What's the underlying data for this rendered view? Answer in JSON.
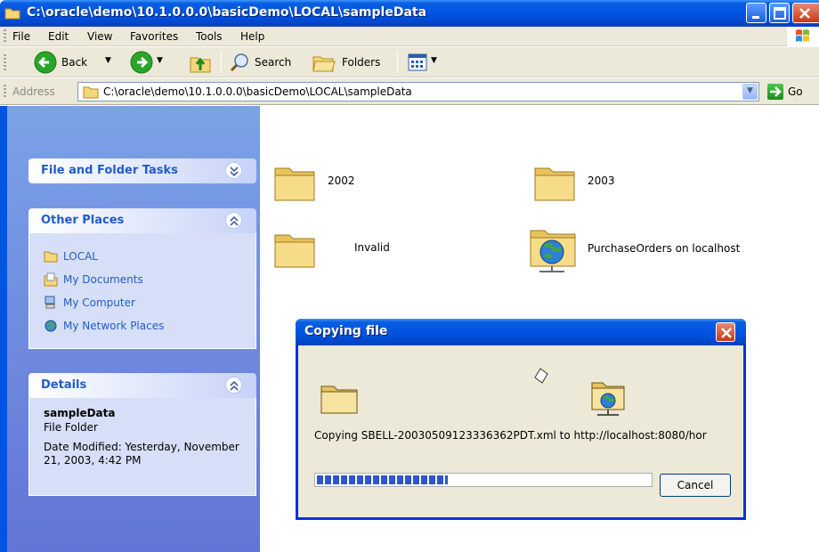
{
  "window": {
    "title": "C:\\oracle\\demo\\10.1.0.0.0\\basicDemo\\LOCAL\\sampleData"
  },
  "menu": [
    "File",
    "Edit",
    "View",
    "Favorites",
    "Tools",
    "Help"
  ],
  "toolbar": {
    "back_label": "Back",
    "search_label": "Search",
    "folders_label": "Folders"
  },
  "address": {
    "label": "Address",
    "value": "C:\\oracle\\demo\\10.1.0.0.0\\basicDemo\\LOCAL\\sampleData",
    "go_label": "Go"
  },
  "taskpane": {
    "file_folder_tasks": {
      "title": "File and Folder Tasks"
    },
    "other_places": {
      "title": "Other Places",
      "items": [
        {
          "label": "LOCAL",
          "icon": "folder-icon"
        },
        {
          "label": "My Documents",
          "icon": "my-documents-icon"
        },
        {
          "label": "My Computer",
          "icon": "my-computer-icon"
        },
        {
          "label": "My Network Places",
          "icon": "network-places-icon"
        }
      ]
    },
    "details": {
      "title": "Details",
      "name": "sampleData",
      "type": "File Folder",
      "modified": "Date Modified: Yesterday, November 21, 2003, 4:42 PM"
    }
  },
  "files": [
    {
      "name": "2002",
      "icon": "folder-icon"
    },
    {
      "name": "2003",
      "icon": "folder-icon"
    },
    {
      "name": "Invalid",
      "icon": "folder-icon"
    },
    {
      "name": "PurchaseOrders on localhost",
      "icon": "web-folder-icon"
    }
  ],
  "dialog": {
    "title": "Copying file",
    "message": "Copying SBELL-20030509123336362PDT.xml to http://localhost:8080/hor",
    "progress": 0.39,
    "cancel_label": "Cancel"
  }
}
